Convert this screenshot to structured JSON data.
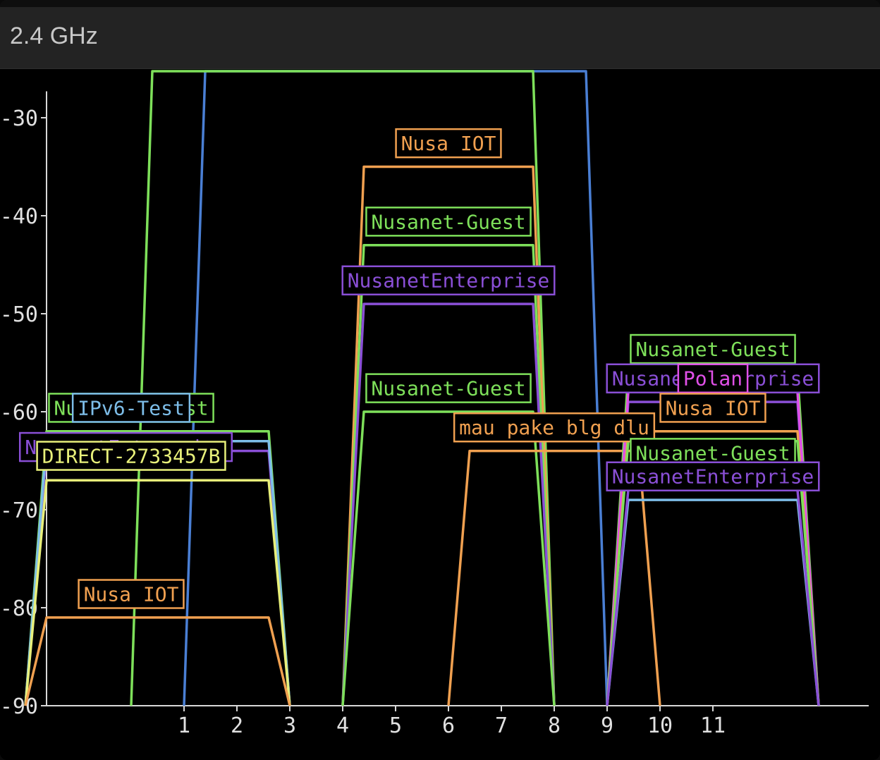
{
  "header": {
    "title": "2.4 GHz"
  },
  "chart_data": {
    "type": "line",
    "xlabel": "",
    "ylabel": "",
    "xlim": [
      -2.3,
      13.2
    ],
    "ylim": [
      -90,
      -27
    ],
    "x_ticks": [
      1,
      2,
      3,
      4,
      5,
      6,
      7,
      8,
      9,
      10,
      11
    ],
    "y_ticks": [
      -30,
      -40,
      -50,
      -60,
      -70,
      -80,
      -90
    ],
    "series": [
      {
        "name": "",
        "color": "#4a7fd4",
        "x": [
          1,
          1.4,
          8.6,
          9
        ],
        "y": [
          -90,
          -22,
          -22,
          -90
        ],
        "label": "",
        "label_x": null,
        "label_y": null
      },
      {
        "name": "",
        "color": "#7ee05a",
        "x": [
          0,
          0.4,
          7.6,
          8
        ],
        "y": [
          -90,
          -22,
          -22,
          -90
        ],
        "label": "",
        "label_x": null,
        "label_y": null
      },
      {
        "name": "Nusanet-Guest",
        "color": "#7ee05a",
        "x": [
          -2,
          -1.6,
          2.6,
          3
        ],
        "y": [
          -90,
          -62,
          -62,
          -90
        ],
        "label": "Nusanet-Guest",
        "label_x": 0,
        "label_y": -59.6
      },
      {
        "name": "NusanetEnterprise",
        "color": "#8a4fd6",
        "x": [
          -2,
          -1.6,
          2.6,
          3
        ],
        "y": [
          -90,
          -64,
          -64,
          -90
        ],
        "label": "NusanetEnterprise",
        "label_x": -0.1,
        "label_y": -63.6
      },
      {
        "name": "IPv6-Test",
        "color": "#7dbde8",
        "x": [
          -2,
          -1.6,
          2.6,
          3
        ],
        "y": [
          -90,
          -63,
          -63,
          -90
        ],
        "label": "IPv6-Test",
        "label_x": 0,
        "label_y": -59.6
      },
      {
        "name": "DIRECT-2733457B",
        "color": "#e8f07a",
        "x": [
          -2,
          -1.6,
          2.6,
          3
        ],
        "y": [
          -90,
          -67,
          -67,
          -90
        ],
        "label": "DIRECT-2733457B",
        "label_x": 0,
        "label_y": -64.5
      },
      {
        "name": "Nusa IOT",
        "color": "#f0a050",
        "x": [
          -2,
          -1.6,
          2.6,
          3
        ],
        "y": [
          -90,
          -81,
          -81,
          -90
        ],
        "label": "Nusa IOT",
        "label_x": 0,
        "label_y": -78.6
      },
      {
        "name": "Nusa IOT",
        "color": "#f0a050",
        "x": [
          4,
          4.4,
          7.6,
          8
        ],
        "y": [
          -90,
          -35,
          -35,
          -90
        ],
        "label": "Nusa IOT",
        "label_x": 6,
        "label_y": -32.6
      },
      {
        "name": "Nusanet-Guest",
        "color": "#7ee05a",
        "x": [
          4,
          4.4,
          7.6,
          8
        ],
        "y": [
          -90,
          -43,
          -43,
          -90
        ],
        "label": "Nusanet-Guest",
        "label_x": 6,
        "label_y": -40.6
      },
      {
        "name": "NusanetEnterprise",
        "color": "#8a4fd6",
        "x": [
          4,
          4.4,
          7.6,
          8
        ],
        "y": [
          -90,
          -49,
          -49,
          -90
        ],
        "label": "NusanetEnterprise",
        "label_x": 6,
        "label_y": -46.6
      },
      {
        "name": "Nusanet-Guest",
        "color": "#7ee05a",
        "x": [
          4,
          4.4,
          7.6,
          8
        ],
        "y": [
          -90,
          -60,
          -60,
          -90
        ],
        "label": "Nusanet-Guest",
        "label_x": 6,
        "label_y": -57.6
      },
      {
        "name": "mau pake blg dlu",
        "color": "#f0a050",
        "x": [
          6,
          6.4,
          9.6,
          10
        ],
        "y": [
          -90,
          -64,
          -64,
          -90
        ],
        "label": "mau pake blg dlu",
        "label_x": 8,
        "label_y": -61.6
      },
      {
        "name": "Nusanet-Guest",
        "color": "#7ee05a",
        "x": [
          9,
          9.4,
          12.6,
          13
        ],
        "y": [
          -90,
          -56,
          -56,
          -90
        ],
        "label": "Nusanet-Guest",
        "label_x": 11,
        "label_y": -53.6
      },
      {
        "name": "NusanetEnterprise",
        "color": "#8a4fd6",
        "x": [
          9,
          9.4,
          12.6,
          13
        ],
        "y": [
          -90,
          -59,
          -59,
          -90
        ],
        "label": "NusanetEnterprise",
        "label_x": 11,
        "label_y": -56.6
      },
      {
        "name": "Polan",
        "color": "#e050e8",
        "x": [
          9,
          9.4,
          12.6,
          13
        ],
        "y": [
          -90,
          -58,
          -58,
          -90
        ],
        "label": "Polan",
        "label_x": 11,
        "label_y": -56.6
      },
      {
        "name": "Nusa IOT",
        "color": "#f0a050",
        "x": [
          9,
          9.4,
          12.6,
          13
        ],
        "y": [
          -90,
          -62,
          -62,
          -90
        ],
        "label": "Nusa IOT",
        "label_x": 11,
        "label_y": -59.6
      },
      {
        "name": "Nusanet-Guest",
        "color": "#7ee05a",
        "x": [
          9,
          9.4,
          12.6,
          13
        ],
        "y": [
          -90,
          -63,
          -63,
          -90
        ],
        "label": "Nusanet-Guest",
        "label_x": 11,
        "label_y": -64.2
      },
      {
        "name": "IPv6-Test",
        "color": "#7dbde8",
        "x": [
          9,
          9.4,
          12.6,
          13
        ],
        "y": [
          -90,
          -69,
          -69,
          -90
        ],
        "label": "IPv6-Test",
        "label_x": 11,
        "label_y": -66.6
      },
      {
        "name": "NusanetEnterprise",
        "color": "#8a4fd6",
        "x": [
          9,
          9.4,
          12.6,
          13
        ],
        "y": [
          -90,
          -68,
          -68,
          -90
        ],
        "label": "NusanetEnterprise",
        "label_x": 11,
        "label_y": -66.6
      }
    ]
  }
}
